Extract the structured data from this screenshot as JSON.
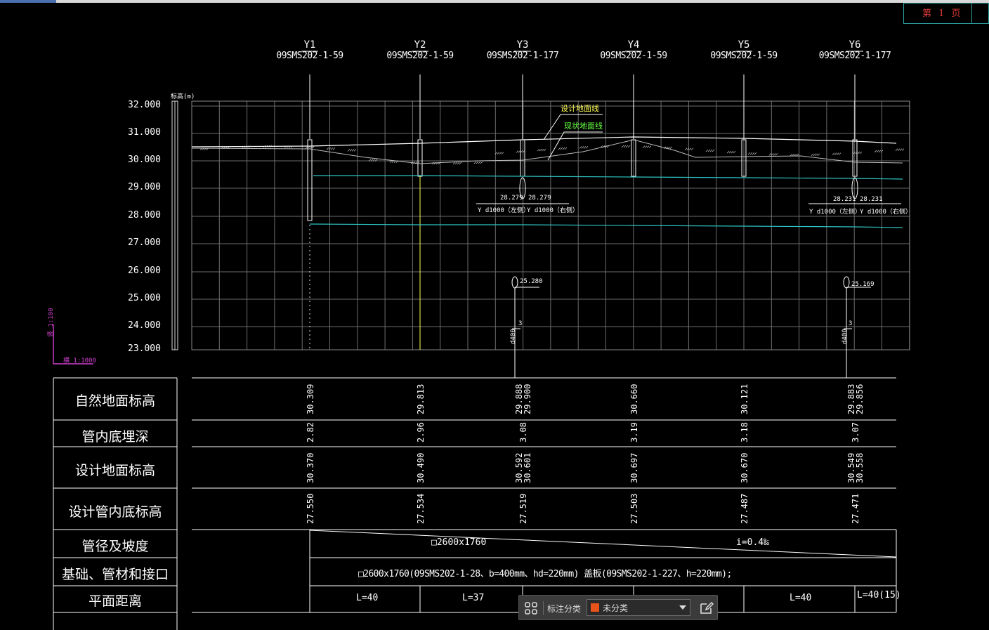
{
  "page": {
    "label": "第 1 页"
  },
  "manholes": [
    {
      "id": "Y1",
      "ref": "09SMS202-1-59"
    },
    {
      "id": "Y2",
      "ref": "09SMS202-1-59"
    },
    {
      "id": "Y3",
      "ref": "09SMS202-1-177"
    },
    {
      "id": "Y4",
      "ref": "09SMS202-1-59"
    },
    {
      "id": "Y5",
      "ref": "09SMS202-1-59"
    },
    {
      "id": "Y6",
      "ref": "09SMS202-1-177"
    }
  ],
  "yaxis": {
    "unit_label": "标高(m)",
    "ticks": [
      "32.000",
      "31.000",
      "30.000",
      "29.000",
      "28.000",
      "27.000",
      "26.000",
      "25.000",
      "24.000",
      "23.000"
    ]
  },
  "legend": {
    "design": "设计地面线",
    "existing": "现状地面线",
    "design_color": "#ffff55",
    "existing_color": "#66ff44"
  },
  "scale": {
    "vertical": "竖 1:100",
    "horizontal": "横 1:1000"
  },
  "branches": {
    "y3_left_elev": "28.279",
    "y3_right_elev": "28.279",
    "y3_left_pipe": "Y d1000（左侧）",
    "y3_right_pipe": "Y d1000（右侧）",
    "y6_left_elev": "28.231",
    "y6_right_elev": "28.231",
    "y6_left_pipe": "Y d1000（左侧）",
    "y6_right_pipe": "Y d1000（右侧）",
    "y3_low_elev": "25.280",
    "y6_low_elev": "25.169",
    "low_pipe_label": "d400",
    "low_num": "3"
  },
  "table": {
    "rows": [
      "自然地面标高",
      "管内底埋深",
      "设计地面标高",
      "设计管内底标高",
      "管径及坡度",
      "基础、管材和接口",
      "平面距离"
    ],
    "natural_ground": [
      "30.309",
      "29.813",
      "29.888\n29.900",
      "30.660",
      "30.121",
      "29.883\n29.856"
    ],
    "burial_depth": [
      "2.82",
      "2.96",
      "3.08",
      "3.19",
      "3.18",
      "3.07"
    ],
    "design_ground": [
      "30.370",
      "30.490",
      "30.592\n30.601",
      "30.697",
      "30.670",
      "30.549\n30.558"
    ],
    "invert": [
      "27.550",
      "27.534",
      "27.519",
      "27.503",
      "27.487",
      "27.471"
    ],
    "pipe_size": "□2600x1760",
    "slope": "i=0.4‰",
    "foundation": "□2600x1760(09SMS202-1-28、b=400mm、hd=220mm) 盖板(09SMS202-1-227、h=220mm);",
    "distances": [
      "L=40",
      "L=37",
      "L=40",
      "L=40(15)"
    ]
  },
  "toolbar": {
    "label": "标注分类",
    "selected": "未分类",
    "swatch": "#e8531c"
  }
}
